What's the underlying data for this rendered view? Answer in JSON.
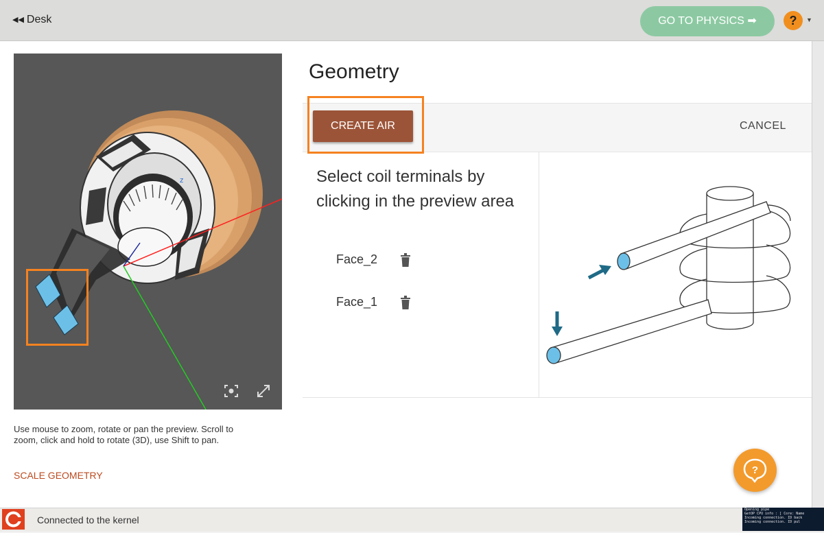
{
  "header": {
    "desk_label": "Desk",
    "go_physics_label": "GO TO PHYSICS",
    "help_label": "?"
  },
  "preview": {
    "axis_label": "z",
    "hint": "Use mouse to zoom, rotate or pan the preview. Scroll to zoom, click and hold to rotate (3D), use Shift to pan.",
    "scale_label": "SCALE GEOMETRY"
  },
  "main": {
    "title": "Geometry",
    "create_air_label": "CREATE AIR",
    "cancel_label": "CANCEL",
    "instruction": "Select coil terminals by clicking in the preview area",
    "faces": [
      {
        "label": "Face_2"
      },
      {
        "label": "Face_1"
      }
    ]
  },
  "status": {
    "text": "Connected to the kernel",
    "console_lines": [
      "Opening pipe",
      "GetOP CPU info : [ Core: Name",
      "Incoming connection. ID back",
      "Incoming connection. ID pul"
    ]
  },
  "colors": {
    "accent_orange": "#f58220",
    "create_air_bg": "#9c5438",
    "go_physics_bg": "#8cc9a2",
    "terminal_blue": "#6cc0e8"
  }
}
